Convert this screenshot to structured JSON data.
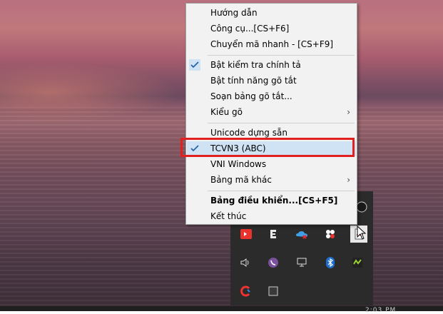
{
  "menu": {
    "items": [
      {
        "label": "Hướng dẫn",
        "checked": false,
        "submenu": false,
        "bold": false
      },
      {
        "label": "Công cụ...[CS+F6]",
        "checked": false,
        "submenu": false,
        "bold": false
      },
      {
        "label": "Chuyển mã nhanh - [CS+F9]",
        "checked": false,
        "submenu": false,
        "bold": false
      },
      {
        "label": "Bật kiểm tra chính tả",
        "checked": true,
        "submenu": false,
        "bold": false
      },
      {
        "label": "Bật tính năng gõ tắt",
        "checked": false,
        "submenu": false,
        "bold": false
      },
      {
        "label": "Soạn bảng gõ tắt...",
        "checked": false,
        "submenu": false,
        "bold": false
      },
      {
        "label": "Kiểu gõ",
        "checked": false,
        "submenu": true,
        "bold": false
      },
      {
        "label": "Unicode dựng sẵn",
        "checked": false,
        "submenu": false,
        "bold": false
      },
      {
        "label": "TCVN3 (ABC)",
        "checked": true,
        "submenu": false,
        "bold": false
      },
      {
        "label": "VNI Windows",
        "checked": false,
        "submenu": false,
        "bold": false
      },
      {
        "label": "Bảng mã khác",
        "checked": false,
        "submenu": true,
        "bold": false
      },
      {
        "label": "Bảng điều khiển...[CS+F5]",
        "checked": false,
        "submenu": false,
        "bold": true
      },
      {
        "label": "Kết thúc",
        "checked": false,
        "submenu": false,
        "bold": false
      }
    ],
    "highlighted_item": "TCVN3 (ABC)",
    "highlight_color": "#e1201f"
  },
  "tray": {
    "icons": [
      "anydesk-icon",
      "evernote-icon",
      "onedrive-icon",
      "slack-icon",
      "file-icon",
      "volume-icon",
      "viber-icon",
      "network-icon",
      "bluetooth-icon",
      "gpu-icon",
      "ccleaner-icon",
      "keyboard-icon"
    ]
  },
  "taskbar": {
    "clock": "2:03 PM"
  }
}
